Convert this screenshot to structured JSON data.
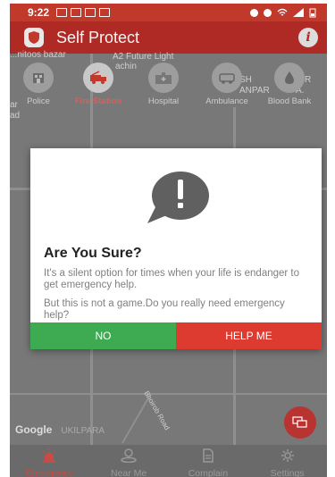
{
  "status_bar": {
    "time": "9:22"
  },
  "app_bar": {
    "title": "Self Protect",
    "info_glyph": "i"
  },
  "map_labels": {
    "top_left": "...nitoos bazar",
    "future": "A2 Future Light",
    "machine": "achin",
    "right1": "SH",
    "right2": "ANPAR",
    "right3": "R",
    "right4": "A.",
    "left1": "ar",
    "left2": "ad",
    "area": "UKILPARA",
    "road": "Bhoirob Road",
    "google": "Google"
  },
  "categories": [
    {
      "label": "Police",
      "icon": "police-icon"
    },
    {
      "label": "Fire Station",
      "icon": "fire-truck-icon"
    },
    {
      "label": "Hospital",
      "icon": "hospital-icon"
    },
    {
      "label": "Ambulance",
      "icon": "ambulance-icon"
    },
    {
      "label": "Blood Bank",
      "icon": "blood-drop-icon"
    }
  ],
  "dialog": {
    "title": "Are You Sure?",
    "message1": "It's a silent option for times when your life is endanger to get emergency help.",
    "message2": "But this is not a game.Do you really need emergency help?",
    "no_label": "NO",
    "help_label": "HELP ME"
  },
  "bottom_nav": [
    {
      "label": "Emergency",
      "icon": "siren-icon",
      "active": true
    },
    {
      "label": "Near Me",
      "icon": "person-location-icon",
      "active": false
    },
    {
      "label": "Complain",
      "icon": "document-icon",
      "active": false
    },
    {
      "label": "Settings",
      "icon": "gear-icon",
      "active": false
    }
  ],
  "colors": {
    "app_bar": "#b02a25",
    "no_button": "#3eaa52",
    "help_button": "#dd3a30",
    "active_accent": "#c84b45"
  }
}
